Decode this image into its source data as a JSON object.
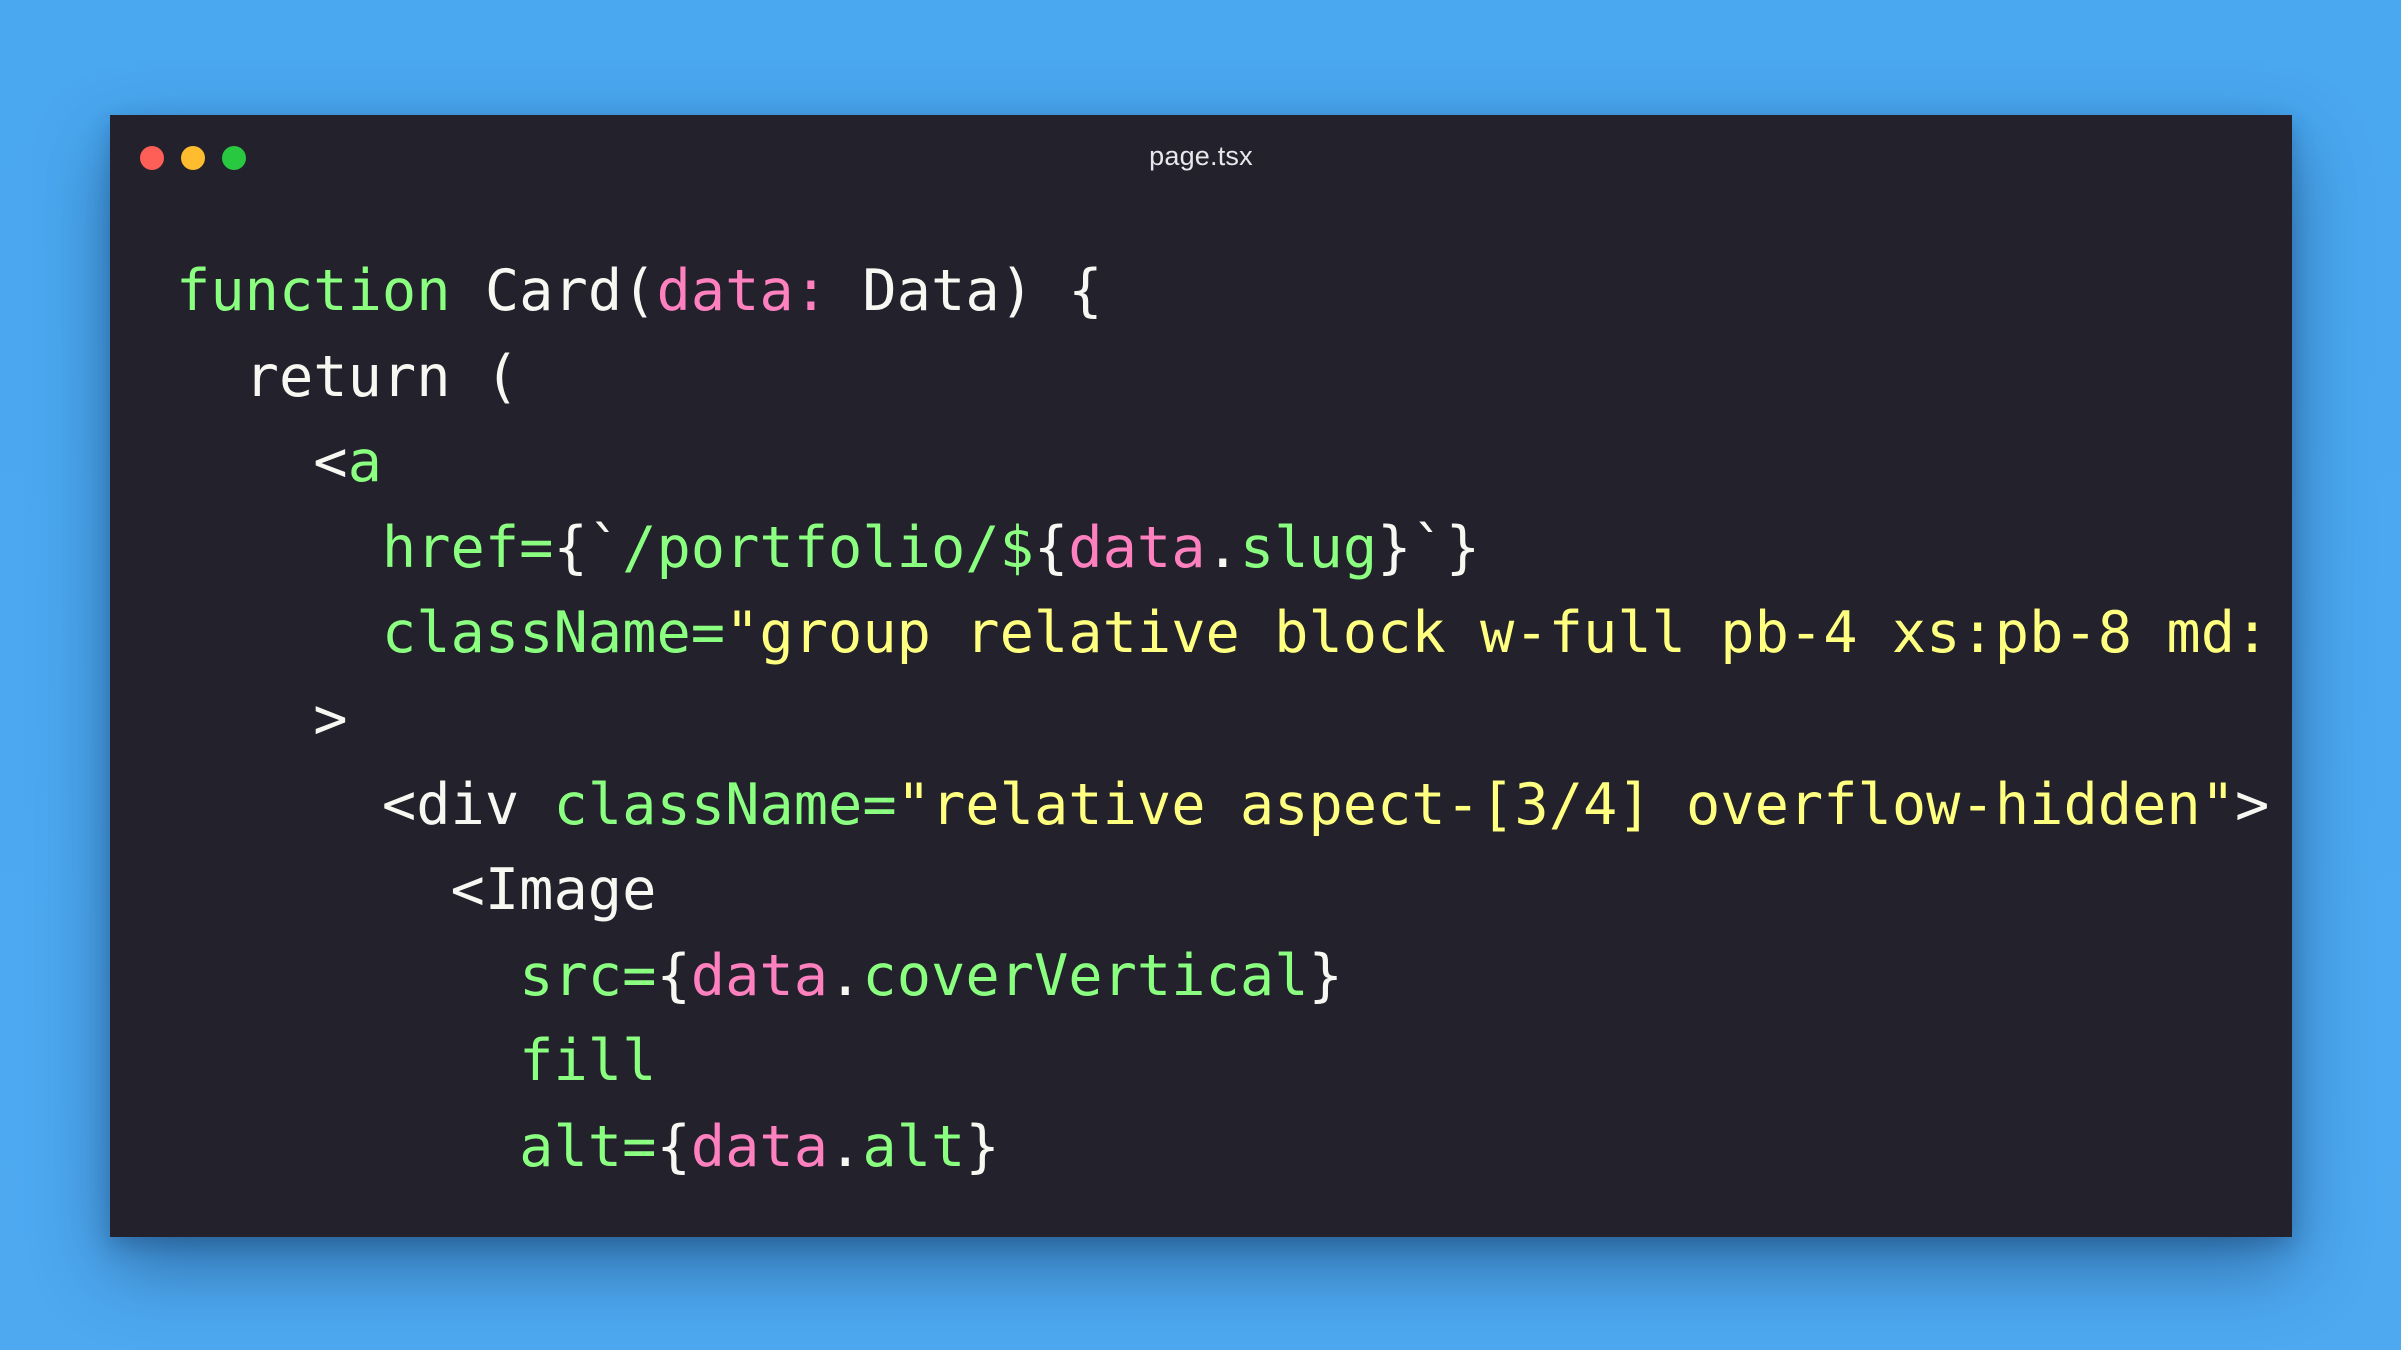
{
  "window": {
    "title": "page.tsx",
    "colors": {
      "background": "#22212c",
      "close": "#ff5f57",
      "minimize": "#febc2e",
      "maximize": "#28c840",
      "keyword": "#8aff80",
      "attribute": "#8aff80",
      "variable": "#ff80bf",
      "string": "#ffff80",
      "text": "#f8f8f2"
    }
  },
  "code": {
    "lines": [
      [
        {
          "text": "function",
          "role": "keyword"
        },
        {
          "text": " Card(",
          "role": "text"
        },
        {
          "text": "data:",
          "role": "variable"
        },
        {
          "text": " Data) {",
          "role": "text"
        }
      ],
      [
        {
          "text": "  return (",
          "role": "text"
        }
      ],
      [
        {
          "text": "    <",
          "role": "text"
        },
        {
          "text": "a",
          "role": "keyword"
        }
      ],
      [
        {
          "text": "      ",
          "role": "text"
        },
        {
          "text": "href=",
          "role": "attribute"
        },
        {
          "text": "{`",
          "role": "text"
        },
        {
          "text": "/portfolio/$",
          "role": "attribute"
        },
        {
          "text": "{",
          "role": "text"
        },
        {
          "text": "data",
          "role": "variable"
        },
        {
          "text": ".",
          "role": "text"
        },
        {
          "text": "slug",
          "role": "attribute"
        },
        {
          "text": "}`}",
          "role": "text"
        }
      ],
      [
        {
          "text": "      ",
          "role": "text"
        },
        {
          "text": "className=",
          "role": "attribute"
        },
        {
          "text": "\"group relative block w-full pb-4 xs:pb-8 md:",
          "role": "string"
        }
      ],
      [
        {
          "text": "    >",
          "role": "text"
        }
      ],
      [
        {
          "text": "      <div ",
          "role": "text"
        },
        {
          "text": "className=",
          "role": "attribute"
        },
        {
          "text": "\"relative aspect-[3/4] overflow-hidden\"",
          "role": "string"
        },
        {
          "text": ">",
          "role": "text"
        }
      ],
      [
        {
          "text": "        <Image",
          "role": "text"
        }
      ],
      [
        {
          "text": "          ",
          "role": "text"
        },
        {
          "text": "src=",
          "role": "attribute"
        },
        {
          "text": "{",
          "role": "text"
        },
        {
          "text": "data",
          "role": "variable"
        },
        {
          "text": ".",
          "role": "text"
        },
        {
          "text": "coverVertical",
          "role": "attribute"
        },
        {
          "text": "}",
          "role": "text"
        }
      ],
      [
        {
          "text": "          ",
          "role": "text"
        },
        {
          "text": "fill",
          "role": "attribute"
        }
      ],
      [
        {
          "text": "          ",
          "role": "text"
        },
        {
          "text": "alt=",
          "role": "attribute"
        },
        {
          "text": "{",
          "role": "text"
        },
        {
          "text": "data",
          "role": "variable"
        },
        {
          "text": ".",
          "role": "text"
        },
        {
          "text": "alt",
          "role": "attribute"
        },
        {
          "text": "}",
          "role": "text"
        }
      ]
    ]
  }
}
